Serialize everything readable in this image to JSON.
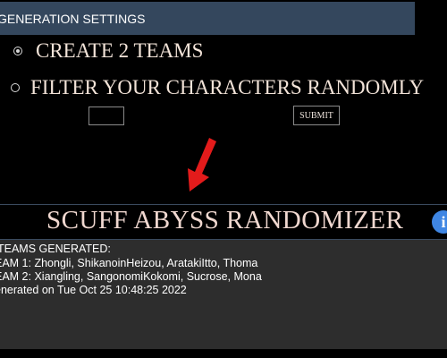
{
  "header": {
    "title": "GENERATION SETTINGS"
  },
  "options": [
    {
      "label": "CREATE 2 TEAMS",
      "selected": true
    },
    {
      "label": "FILTER YOUR CHARACTERS RANDOMLY",
      "selected": false
    }
  ],
  "form": {
    "input_value": "",
    "submit_label": "SUBMIT"
  },
  "arrow": {
    "icon": "down-left-arrow-icon",
    "color": "#e31b1b"
  },
  "title_band": {
    "title": "SCUFF ABYSS RANDOMIZER",
    "info_glyph": "i",
    "info_color": "#3f86e3"
  },
  "results": {
    "lines": [
      "TEAMS GENERATED:",
      "EAM 1: Zhongli, ShikanoinHeizou, AratakiItto, Thoma",
      "EAM 2: Xiangling, SangonomiKokomi, Sucrose, Mona",
      "enerated on Tue Oct 25 10:48:25 2022"
    ]
  },
  "colors": {
    "header_bg": "#34475d",
    "results_bg": "#2d2d2d",
    "page_bg": "#000000"
  }
}
